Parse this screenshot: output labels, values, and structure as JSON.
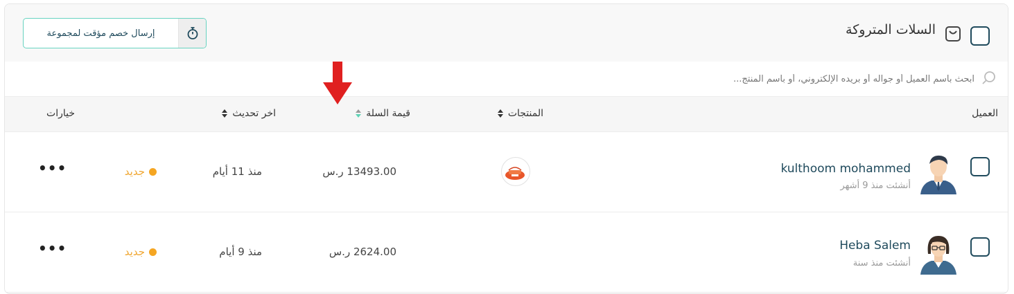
{
  "header": {
    "title": "السلات المتروكة",
    "title_icon": "shopping-bag-icon",
    "discount_button": {
      "label": "إرسال خصم مؤقت لمجموعة",
      "icon": "stopwatch-icon"
    }
  },
  "search": {
    "placeholder": "ابحث باسم العميل أو جواله أو بريده الإلكتروني، أو باسم المنتج...",
    "value": ""
  },
  "table": {
    "columns": {
      "customer": "العميل",
      "products": "المنتجات",
      "cart_value": "قيمة السلة",
      "last_update": "اخر تحديث",
      "options": "خيارات"
    },
    "rows": [
      {
        "name": "kulthoom mohammed",
        "created": "أنشئت منذ 9 أشهر",
        "avatar": "male-avatar",
        "cart_value": "13493.00 ر.س",
        "last_update": "منذ 11 أيام",
        "status": "جديد",
        "options": "•••"
      },
      {
        "name": "Heba Salem",
        "created": "أنشئت منذ سنة",
        "avatar": "female-avatar",
        "cart_value": "2624.00 ر.س",
        "last_update": "منذ 9 أيام",
        "status": "جديد",
        "options": "•••"
      }
    ]
  },
  "colors": {
    "accent": "#67d3c0",
    "primary_text": "#1f4a5c",
    "status_new": "#f5a623",
    "annotation_arrow": "#e02020"
  }
}
